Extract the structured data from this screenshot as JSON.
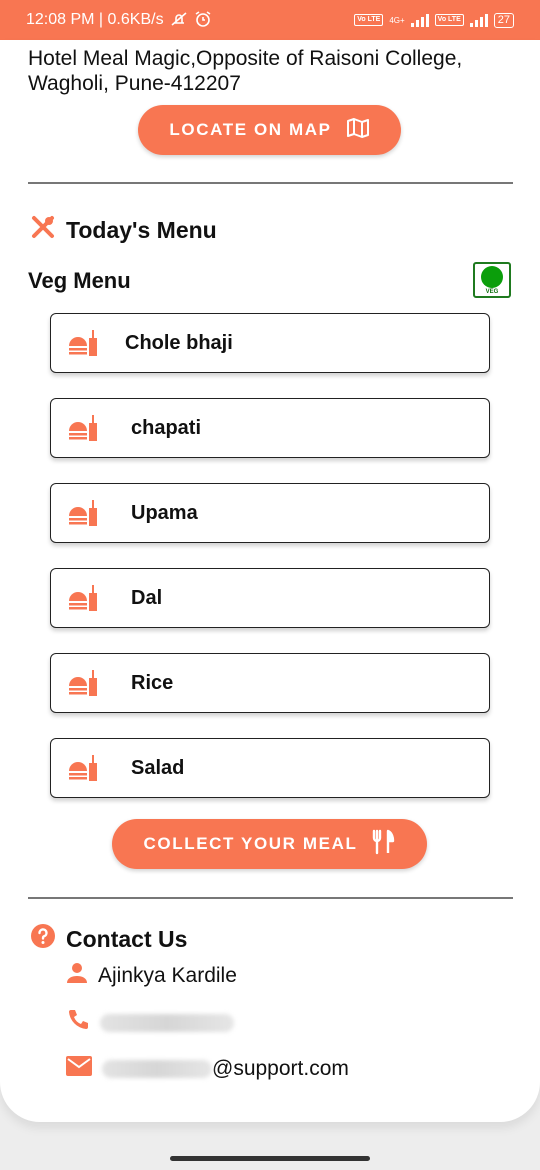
{
  "status_bar": {
    "time_speed": "12:08 PM | 0.6KB/s",
    "network_type": "4G+",
    "lte_label": "Vo LTE",
    "battery": "27",
    "icons": [
      "silent-icon",
      "alarm-icon",
      "signal-icon",
      "battery-icon"
    ]
  },
  "address": "Hotel Meal Magic,Opposite of Raisoni College, Wagholi, Pune-412207",
  "locate_button": "LOCATE ON MAP",
  "today_menu": {
    "title": "Today's Menu",
    "veg_heading": "Veg Menu",
    "veg_badge": "VEG",
    "items": [
      "Chole bhaji",
      "chapati",
      "Upama",
      "Dal",
      "Rice",
      "Salad"
    ]
  },
  "collect_button": "COLLECT YOUR MEAL",
  "contact": {
    "title": "Contact Us",
    "name": "Ajinkya Kardile",
    "email_suffix": "@support.com"
  },
  "colors": {
    "accent": "#f87652",
    "veg_green": "#0b9e0b"
  }
}
